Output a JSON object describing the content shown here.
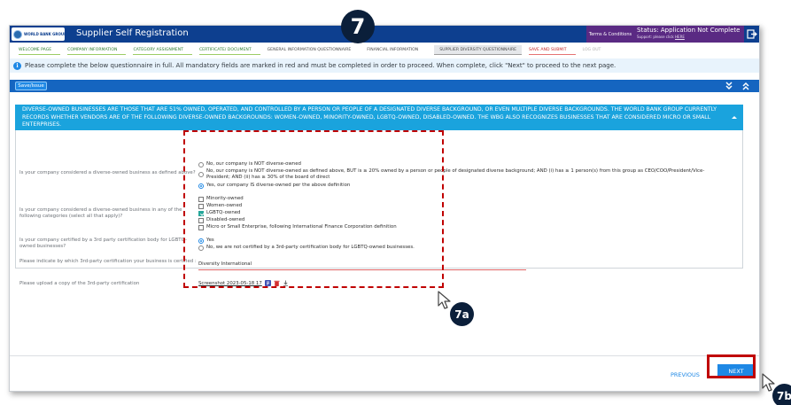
{
  "header": {
    "logo_text": "WORLD BANK GROUP",
    "app_title": "Supplier Self Registration",
    "terms_label": "Terms & Conditions",
    "status_label": "Status: Application Not Complete",
    "support_text": "Support: please click",
    "support_link": "HERE"
  },
  "tabs": [
    {
      "label": "WELCOME PAGE"
    },
    {
      "label": "COMPANY INFORMATION"
    },
    {
      "label": "CATEGORY ASSIGNMENT"
    },
    {
      "label": "CERTIFICATE/ DOCUMENT"
    },
    {
      "label": "GENERAL INFORMATION QUESTIONNAIRE"
    },
    {
      "label": "FINANCIAL INFORMATION"
    },
    {
      "label": "SUPPLIER DIVERSITY QUESTIONNAIRE"
    },
    {
      "label": "SAVE AND SUBMIT"
    },
    {
      "label": "LOG OUT"
    }
  ],
  "notice": "Please complete the below questionnaire in full. All mandatory fields are marked in red and must be completed in order to proceed. When complete, click \"Next\" to proceed to the next page.",
  "toolbar": {
    "save_issue_label": "Save/Issue"
  },
  "section_banner": "DIVERSE-OWNED BUSINESSES ARE THOSE THAT ARE 51% OWNED, OPERATED, AND CONTROLLED BY A PERSON OR PEOPLE OF A DESIGNATED DIVERSE BACKGROUND, OR EVEN MULTIPLE DIVERSE BACKGROUNDS. THE WORLD BANK GROUP CURRENTLY RECORDS WHETHER VENDORS ARE OF THE FOLLOWING DIVERSE-OWNED BACKGROUNDS: WOMEN-OWNED, MINORITY-OWNED, LGBTQ-OWNED, DISABLED-OWNED. THE WBG ALSO RECOGNIZES BUSINESSES THAT ARE CONSIDERED MICRO OR SMALL ENTERPRISES.",
  "questions": {
    "q1": {
      "label": "Is your company considered a diverse-owned business as defined above?",
      "options": [
        "No, our company is NOT diverse-owned",
        "No, our company is NOT diverse-owned as defined above, BUT is ≥ 20% owned by a person or people of designated diverse background; AND (i) has ≥ 1 person(s) from this group as CEO/COO/President/Vice-",
        "President; AND (ii) has ≥ 30% of the board of direct",
        "Yes, our company IS diverse-owned per the above definition"
      ],
      "selected": "Yes, our company IS diverse-owned per the above definition"
    },
    "q2": {
      "label": "Is your company considered a diverse-owned business in any of the following categories (select all that apply)?",
      "options": [
        "Minority-owned",
        "Women-owned",
        "LGBTQ-owned",
        "Disabled-owned",
        "Micro or Small Enterprise, following International Finance Corporation definition"
      ],
      "checked": [
        "LGBTQ-owned"
      ]
    },
    "q3": {
      "label": "Is your company certified by a 3rd party certification body for LGBTQ-owned businesses?",
      "options": [
        "Yes",
        "No, we are not certified by a 3rd-party certification body for LGBTQ-owned businesses."
      ],
      "selected": "Yes"
    },
    "q4": {
      "label": "Please indicate by which 3rd-party certification your business is certified :",
      "value": "Diversity International"
    },
    "q5": {
      "label": "Please upload a copy of the 3rd-party certification",
      "file_name": "Screenshot 2023-05-18 17"
    }
  },
  "footer": {
    "previous_label": "PREVIOUS",
    "next_label": "NEXT"
  },
  "annotations": {
    "step": "7",
    "callout_a": "7a",
    "callout_b": "7b"
  },
  "colors": {
    "header": "#0d3f8f",
    "accent": "#1e88e5",
    "banner": "#1aa3dd",
    "terms": "#5a2a83",
    "highlight": "#c00000",
    "callout": "#0b1f3a"
  },
  "icons": [
    "exit-icon",
    "info-icon",
    "chevron-double-down-icon",
    "chevron-double-up-icon",
    "caret-up-icon",
    "view-file-icon",
    "delete-file-icon",
    "download-icon",
    "mouse-cursor-icon"
  ]
}
